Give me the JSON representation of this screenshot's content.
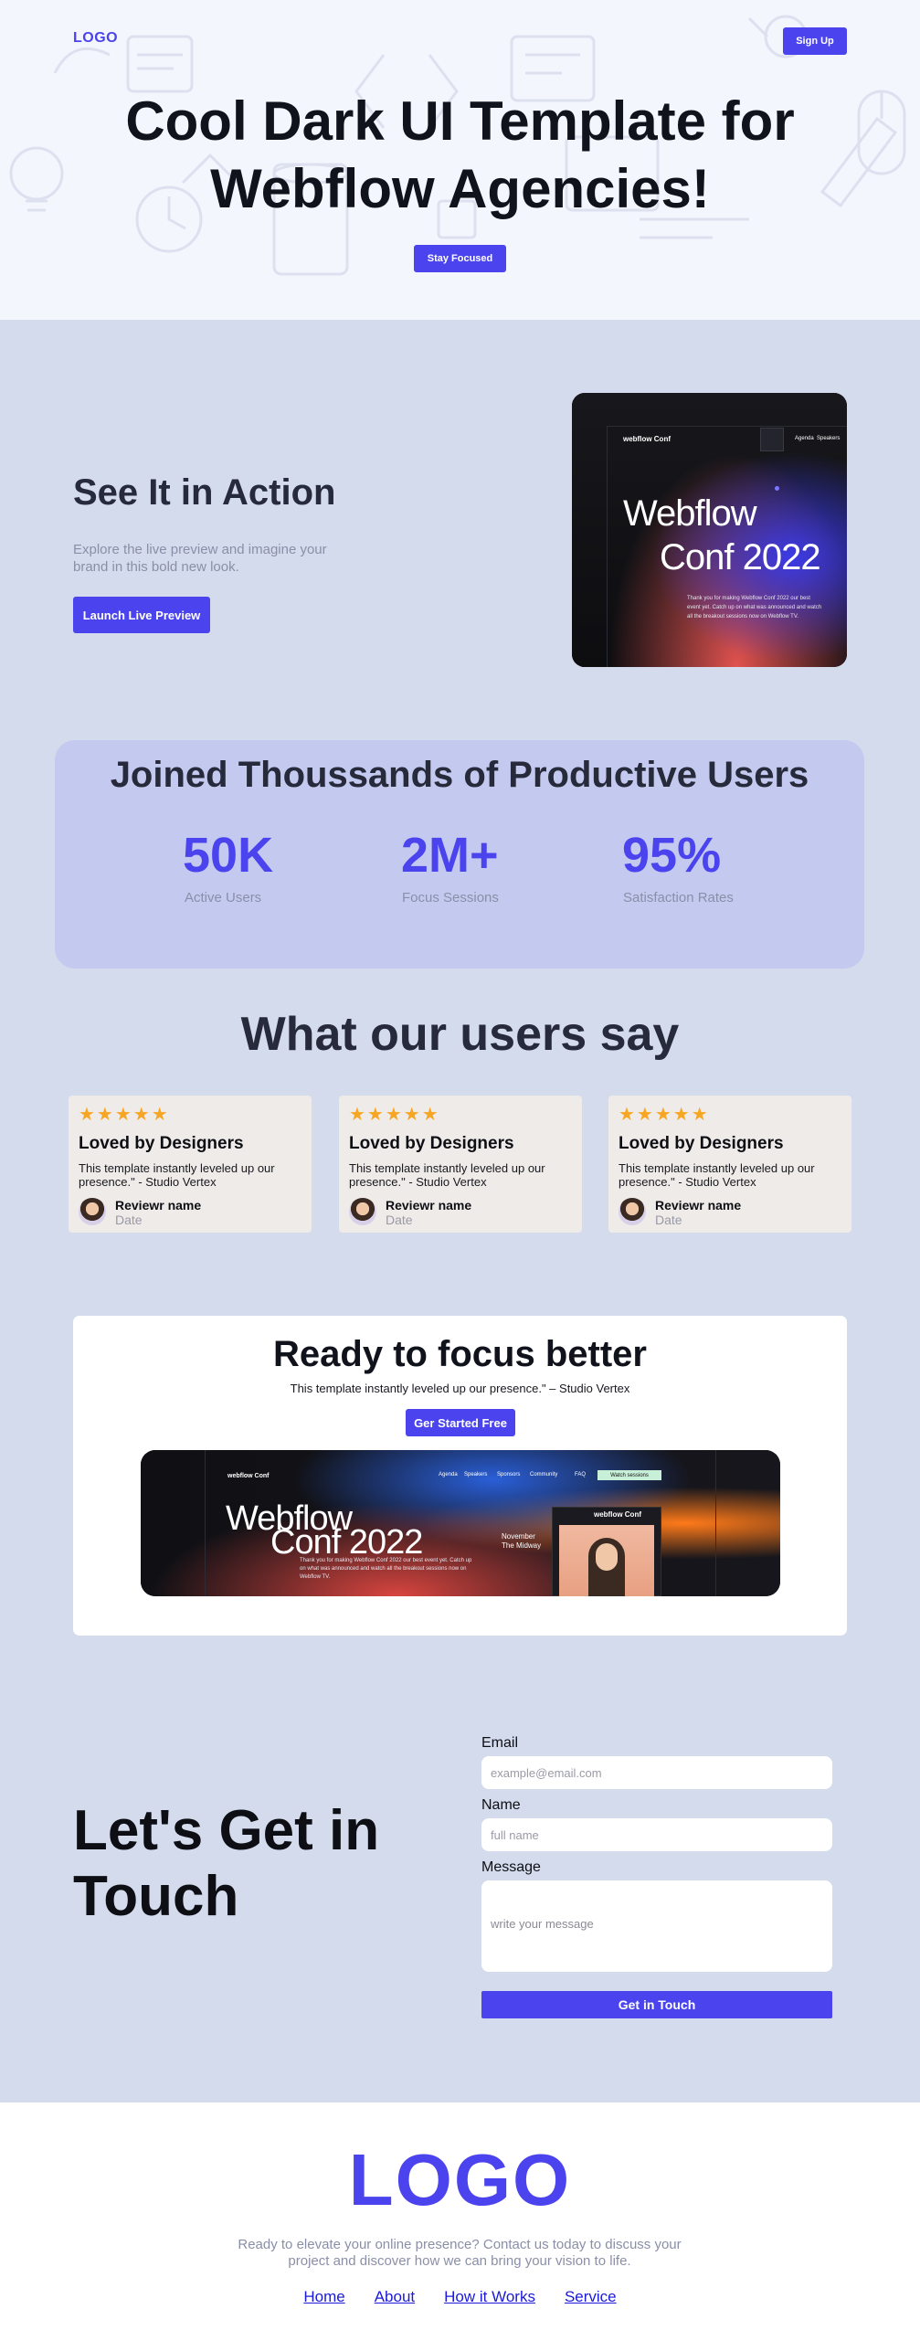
{
  "header": {
    "logo": "LOGO",
    "signup_label": "Sign Up"
  },
  "hero": {
    "title": "Cool Dark UI Template for Webflow Agencies!",
    "cta_label": "Stay Focused"
  },
  "action": {
    "title": "See It in Action",
    "description": "Explore the live preview and imagine your brand in this bold new look.",
    "cta_label": "Launch Live Preview",
    "preview": {
      "brand": "webflow Conf",
      "nav": [
        "Agenda",
        "Speakers"
      ],
      "headline_1": "Webflow",
      "headline_2": "Conf 2022",
      "body": "Thank you for making Webflow Conf 2022 our best event yet. Catch up on what was announced and watch all the breakout sessions now on Webflow TV."
    }
  },
  "stats": {
    "title": "Joined Thoussands of Productive Users",
    "items": [
      {
        "value": "50K",
        "label": "Active Users"
      },
      {
        "value": "2M+",
        "label": "Focus Sessions"
      },
      {
        "value": "95%",
        "label": "Satisfaction Rates"
      }
    ]
  },
  "testimonials": {
    "title": "What our users say",
    "stars": "★★★★★",
    "items": [
      {
        "title": "Loved by Designers",
        "text": "This template instantly leveled up our presence.\" - Studio Vertex",
        "name": "Reviewr name",
        "date": "Date"
      },
      {
        "title": "Loved by Designers",
        "text": "This template instantly leveled up our presence.\" - Studio Vertex",
        "name": "Reviewr name",
        "date": "Date"
      },
      {
        "title": "Loved by Designers",
        "text": "This template instantly leveled up our presence.\" - Studio Vertex",
        "name": "Reviewr name",
        "date": "Date"
      }
    ]
  },
  "ready": {
    "title": "Ready to focus better",
    "subtitle": "This template instantly leveled up our presence.\" – Studio Vertex",
    "cta_label": "Ger Started Free",
    "preview": {
      "brand": "webflow Conf",
      "nav": [
        "Agenda",
        "Speakers",
        "Sponsors",
        "Community",
        "FAQ"
      ],
      "watch_label": "Watch sessions",
      "headline_1": "Webflow",
      "headline_2": "Conf 2022",
      "body": "Thank you for making Webflow Conf 2022 our best event yet. Catch up on what was announced and watch all the breakout sessions now on Webflow TV.",
      "side_brand": "webflow Conf",
      "side_text_1": "November",
      "side_text_2": "The Midway"
    }
  },
  "contact": {
    "title": "Let's Get in Touch",
    "email_label": "Email",
    "email_placeholder": "example@email.com",
    "name_label": "Name",
    "name_placeholder": "full name",
    "message_label": "Message",
    "message_placeholder": "write your message",
    "submit_label": "Get in Touch"
  },
  "footer": {
    "logo": "LOGO",
    "text": "Ready to elevate your online presence? Contact us today to discuss your project and discover how we can bring your vision to life.",
    "links": [
      "Home",
      "About",
      "How it Works",
      "Service"
    ]
  },
  "colors": {
    "accent": "#4b44ee",
    "page_bg": "#d4dbed",
    "stats_bg": "#c4caef",
    "star": "#f6a623"
  }
}
